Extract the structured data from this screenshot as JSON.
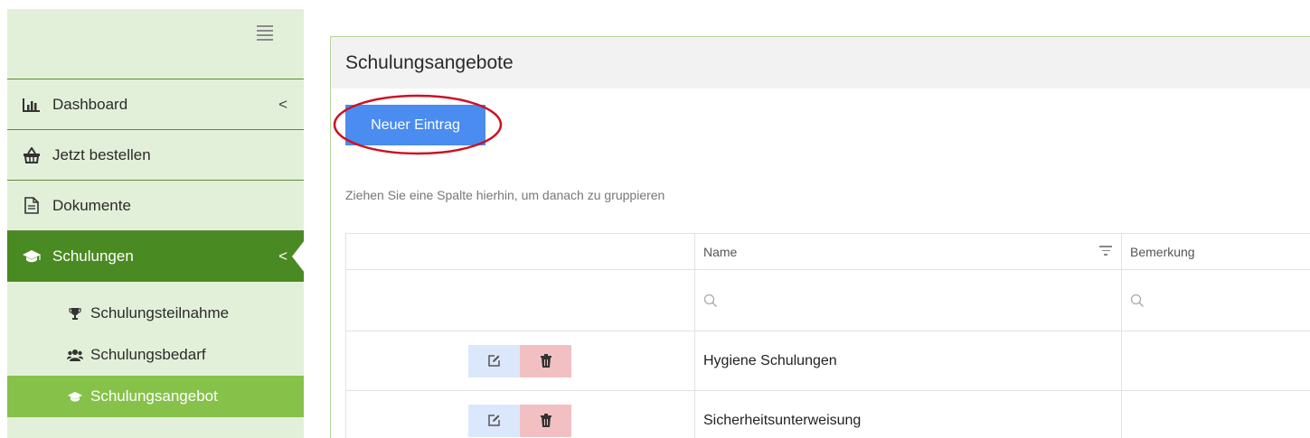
{
  "sidebar": {
    "menu_icon": "hamburger-icon",
    "items": [
      {
        "label": "Dashboard",
        "icon": "bar-chart-icon",
        "chevron": "<"
      },
      {
        "label": "Jetzt bestellen",
        "icon": "basket-icon"
      },
      {
        "label": "Dokumente",
        "icon": "document-icon"
      },
      {
        "label": "Schulungen",
        "icon": "graduation-cap-icon",
        "chevron": "<",
        "active": true
      }
    ],
    "sub_items": [
      {
        "label": "Schulungsteilnahme",
        "icon": "trophy-icon"
      },
      {
        "label": "Schulungsbedarf",
        "icon": "users-icon"
      },
      {
        "label": "Schulungsangebot",
        "icon": "graduation-cap-icon",
        "active": true
      }
    ]
  },
  "panel": {
    "title": "Schulungsangebote",
    "new_button": "Neuer Eintrag",
    "group_hint": "Ziehen Sie eine Spalte hierhin, um danach zu gruppieren"
  },
  "grid": {
    "columns": [
      "",
      "Name",
      "Bemerkung"
    ],
    "rows": [
      {
        "name": "Hygiene Schulungen",
        "bemerkung": ""
      },
      {
        "name": "Sicherheitsunterweisung",
        "bemerkung": ""
      }
    ]
  },
  "colors": {
    "sidebar_bg": "#e3f0d9",
    "active_green": "#4a8a22",
    "sub_active_green": "#86c24a",
    "primary_button": "#4a8cf0",
    "annotation_red": "#cc1122"
  }
}
